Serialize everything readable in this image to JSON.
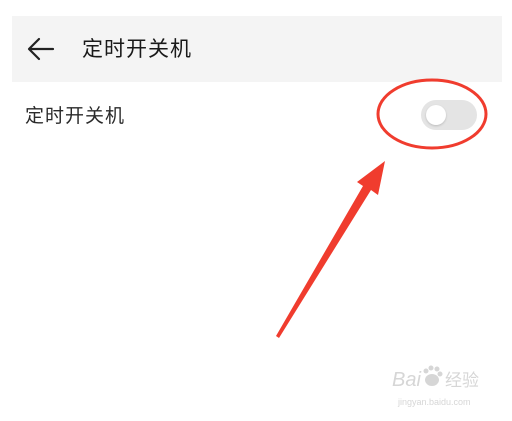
{
  "header": {
    "title": "定时开关机",
    "back_icon": "back-arrow-icon",
    "background": "#f4f4f4"
  },
  "setting": {
    "label": "定时开关机",
    "toggle_state": "off",
    "toggle_color": "#e4e4e4"
  },
  "annotation": {
    "color": "#f03c2e",
    "shapes": [
      "circle",
      "arrow"
    ]
  },
  "watermark": {
    "text": "Bai经验",
    "url": "jingyan.baidu.com",
    "icon": "baidu-paw-icon"
  }
}
